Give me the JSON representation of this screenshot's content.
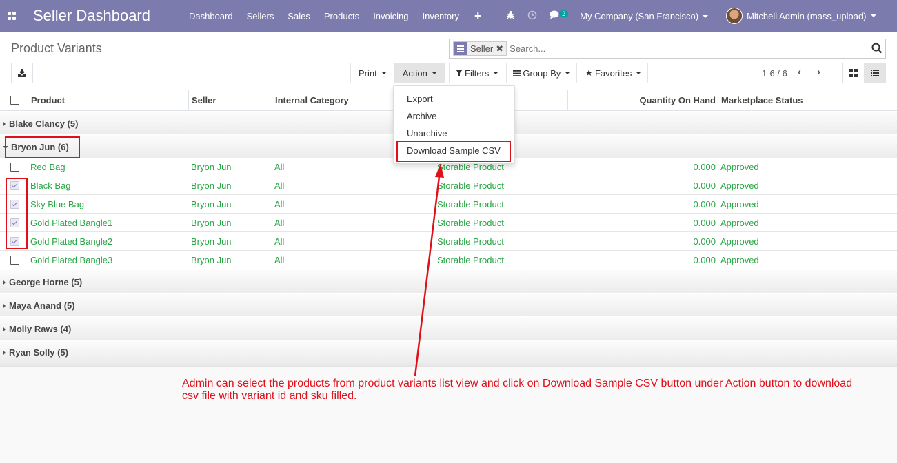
{
  "nav": {
    "brand": "Seller Dashboard",
    "menu": [
      "Dashboard",
      "Sellers",
      "Sales",
      "Products",
      "Invoicing",
      "Inventory"
    ],
    "plus": "+",
    "chat_badge": "2",
    "company": "My Company (San Francisco)",
    "user": "Mitchell Admin (mass_upload)"
  },
  "control_panel": {
    "title": "Product Variants",
    "facet_label": "Seller",
    "search_placeholder": "Search...",
    "print_label": "Print",
    "action_label": "Action",
    "filters_label": "Filters",
    "groupby_label": "Group By",
    "favorites_label": "Favorites",
    "pager": "1-6 / 6"
  },
  "action_menu": [
    "Export",
    "Archive",
    "Unarchive",
    "Download Sample CSV"
  ],
  "table": {
    "columns": [
      "Product",
      "Seller",
      "Internal Category",
      "Quantity On Hand",
      "Marketplace Status"
    ],
    "groups": [
      {
        "name": "Blake Clancy (5)"
      },
      {
        "name": "Bryon Jun (6)"
      },
      {
        "name": "George Horne (5)"
      },
      {
        "name": "Maya Anand (5)"
      },
      {
        "name": "Molly Raws (4)"
      },
      {
        "name": "Ryan Solly (5)"
      }
    ],
    "rows": [
      {
        "product": "Red Bag",
        "seller": "Bryon Jun",
        "category": "All",
        "type": "Storable Product",
        "qty": "0.000",
        "status": "Approved",
        "checked": false
      },
      {
        "product": "Black Bag",
        "seller": "Bryon Jun",
        "category": "All",
        "type": "Storable Product",
        "qty": "0.000",
        "status": "Approved",
        "checked": true
      },
      {
        "product": "Sky Blue Bag",
        "seller": "Bryon Jun",
        "category": "All",
        "type": "Storable Product",
        "qty": "0.000",
        "status": "Approved",
        "checked": true
      },
      {
        "product": "Gold Plated Bangle1",
        "seller": "Bryon Jun",
        "category": "All",
        "type": "Storable Product",
        "qty": "0.000",
        "status": "Approved",
        "checked": true
      },
      {
        "product": "Gold Plated Bangle2",
        "seller": "Bryon Jun",
        "category": "All",
        "type": "Storable Product",
        "qty": "0.000",
        "status": "Approved",
        "checked": true
      },
      {
        "product": "Gold Plated Bangle3",
        "seller": "Bryon Jun",
        "category": "All",
        "type": "Storable Product",
        "qty": "0.000",
        "status": "Approved",
        "checked": false
      }
    ]
  },
  "annotation": {
    "text": "Admin can select the products from product variants list view and click  on Download Sample CSV button under Action button to download csv file with variant id and sku filled.",
    "color": "#e0101a"
  },
  "colors": {
    "brand": "#7c7bad",
    "green_text": "#28a745"
  }
}
